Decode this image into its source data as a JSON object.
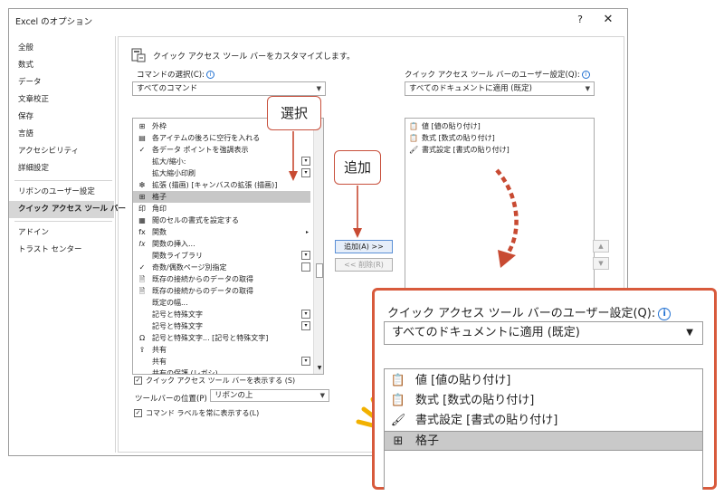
{
  "window": {
    "title": "Excel のオプション",
    "help": "?",
    "close": "✕"
  },
  "nav": {
    "items": [
      "全般",
      "数式",
      "データ",
      "文章校正",
      "保存",
      "言語",
      "アクセシビリティ",
      "詳細設定",
      "リボンのユーザー設定",
      "クイック アクセス ツール バー",
      "アドイン",
      "トラスト センター"
    ],
    "selected": "クイック アクセス ツール バー"
  },
  "header": {
    "text": "クイック アクセス ツール バーをカスタマイズします。"
  },
  "left": {
    "label": "コマンドの選択(C):",
    "combo_value": "すべてのコマンド",
    "commands": [
      {
        "icon": "border-icon",
        "glyph": "⊞",
        "label": "外枠",
        "sub": "▸"
      },
      {
        "icon": "insert-space-icon",
        "glyph": "▤",
        "label": "各アイテムの後ろに空行を入れる"
      },
      {
        "icon": "check-icon",
        "glyph": "✓",
        "label": "各データ ポイントを強調表示"
      },
      {
        "icon": "none",
        "glyph": "",
        "label": "拡大/縮小:"
      },
      {
        "icon": "none",
        "glyph": "",
        "label": "拡大縮小印刷"
      },
      {
        "icon": "canvas-expand-icon",
        "glyph": "❇",
        "label": "拡張 (描画) [キャンバスの拡張 (描画)]"
      },
      {
        "icon": "gridlines-icon",
        "glyph": "⊞",
        "label": "格子"
      },
      {
        "icon": "stamp-icon",
        "glyph": "印",
        "label": "角印"
      },
      {
        "icon": "format-cells-icon",
        "glyph": "▦",
        "label": "閲のセルの書式を設定する"
      },
      {
        "icon": "function-icon",
        "glyph": "fx",
        "label": "関数",
        "sub": "▸"
      },
      {
        "icon": "fx-icon",
        "glyph": "𝑓𝑥",
        "label": "関数の挿入..."
      },
      {
        "icon": "none",
        "glyph": "",
        "label": "関数ライブラリ"
      },
      {
        "icon": "check-icon",
        "glyph": "✓",
        "label": "奇数/偶数ページ別指定"
      },
      {
        "icon": "data-connection-icon",
        "glyph": "🗎",
        "label": "既存の接続からのデータの取得"
      },
      {
        "icon": "data-connection-icon",
        "glyph": "🗎",
        "label": "既存の接続からのデータの取得"
      },
      {
        "icon": "none",
        "glyph": "",
        "label": "既定の幅..."
      },
      {
        "icon": "none",
        "glyph": "",
        "label": "記号と特殊文字"
      },
      {
        "icon": "none",
        "glyph": "",
        "label": "記号と特殊文字"
      },
      {
        "icon": "omega-icon",
        "glyph": "Ω",
        "label": "記号と特殊文字... [記号と特殊文字]"
      },
      {
        "icon": "share-icon",
        "glyph": "⇪",
        "label": "共有"
      },
      {
        "icon": "none",
        "glyph": "",
        "label": "共有"
      },
      {
        "icon": "none",
        "glyph": "",
        "label": "共有の保護 (レガシ)"
      }
    ],
    "selected_index": 6
  },
  "buttons": {
    "add": "追加(A) >>",
    "remove": "<< 削除(R)"
  },
  "right": {
    "label": "クイック アクセス ツール バーのユーザー設定(Q):",
    "combo_value": "すべてのドキュメントに適用 (既定)",
    "items": [
      {
        "icon": "paste-values-icon",
        "glyph": "📋",
        "label": "値 [値の貼り付け]"
      },
      {
        "icon": "paste-formulas-icon",
        "glyph": "📋",
        "label": "数式 [数式の貼り付け]"
      },
      {
        "icon": "paste-formatting-icon",
        "glyph": "🖌",
        "label": "書式設定 [書式の貼り付け]"
      }
    ]
  },
  "bottom": {
    "show_qat_label": "クイック アクセス ツール バーを表示する (S)",
    "toolbar_position_label": "ツールバーの位置(P)",
    "toolbar_position_value": "リボンの上",
    "show_labels_label": "コマンド ラベルを常に表示する(L)"
  },
  "callouts": {
    "select": "選択",
    "add": "追加"
  },
  "zoom": {
    "label": "クイック アクセス ツール バーのユーザー設定(Q):",
    "combo_value": "すべてのドキュメントに適用 (既定)",
    "items": [
      {
        "icon": "paste-values-icon",
        "glyph": "📋",
        "label": "値 [値の貼り付け]"
      },
      {
        "icon": "paste-formulas-icon",
        "glyph": "📋",
        "label": "数式 [数式の貼り付け]"
      },
      {
        "icon": "paste-formatting-icon",
        "glyph": "🖌",
        "label": "書式設定 [書式の貼り付け]"
      },
      {
        "icon": "gridlines-icon",
        "glyph": "⊞",
        "label": "格子"
      }
    ],
    "selected_index": 3
  },
  "colors": {
    "callout_border": "#c8503c",
    "zoom_border": "#d85a3c",
    "arrow": "#c84a32",
    "spark": "#f2b100"
  }
}
